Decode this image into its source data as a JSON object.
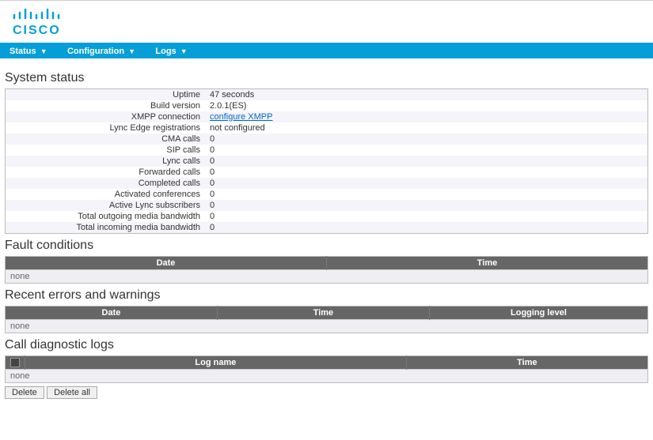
{
  "brand": "CISCO",
  "nav": {
    "items": [
      {
        "label": "Status"
      },
      {
        "label": "Configuration"
      },
      {
        "label": "Logs"
      }
    ]
  },
  "system_status": {
    "title": "System status",
    "rows": [
      {
        "label": "Uptime",
        "value": "47 seconds",
        "link": false
      },
      {
        "label": "Build version",
        "value": "2.0.1(ES)",
        "link": false
      },
      {
        "label": "XMPP connection",
        "value": "configure XMPP",
        "link": true
      },
      {
        "label": "Lync Edge registrations",
        "value": "not configured",
        "link": false
      },
      {
        "label": "CMA calls",
        "value": "0",
        "link": false
      },
      {
        "label": "SIP calls",
        "value": "0",
        "link": false
      },
      {
        "label": "Lync calls",
        "value": "0",
        "link": false
      },
      {
        "label": "Forwarded calls",
        "value": "0",
        "link": false
      },
      {
        "label": "Completed calls",
        "value": "0",
        "link": false
      },
      {
        "label": "Activated conferences",
        "value": "0",
        "link": false
      },
      {
        "label": "Active Lync subscribers",
        "value": "0",
        "link": false
      },
      {
        "label": "Total outgoing media bandwidth",
        "value": "0",
        "link": false
      },
      {
        "label": "Total incoming media bandwidth",
        "value": "0",
        "link": false
      }
    ]
  },
  "fault_conditions": {
    "title": "Fault conditions",
    "headers": [
      "Date",
      "Time"
    ],
    "empty_text": "none"
  },
  "recent_errors": {
    "title": "Recent errors and warnings",
    "headers": [
      "Date",
      "Time",
      "Logging level"
    ],
    "empty_text": "none"
  },
  "call_logs": {
    "title": "Call diagnostic logs",
    "headers": [
      "Log name",
      "Time"
    ],
    "empty_text": "none",
    "buttons": {
      "delete": "Delete",
      "delete_all": "Delete all"
    }
  }
}
